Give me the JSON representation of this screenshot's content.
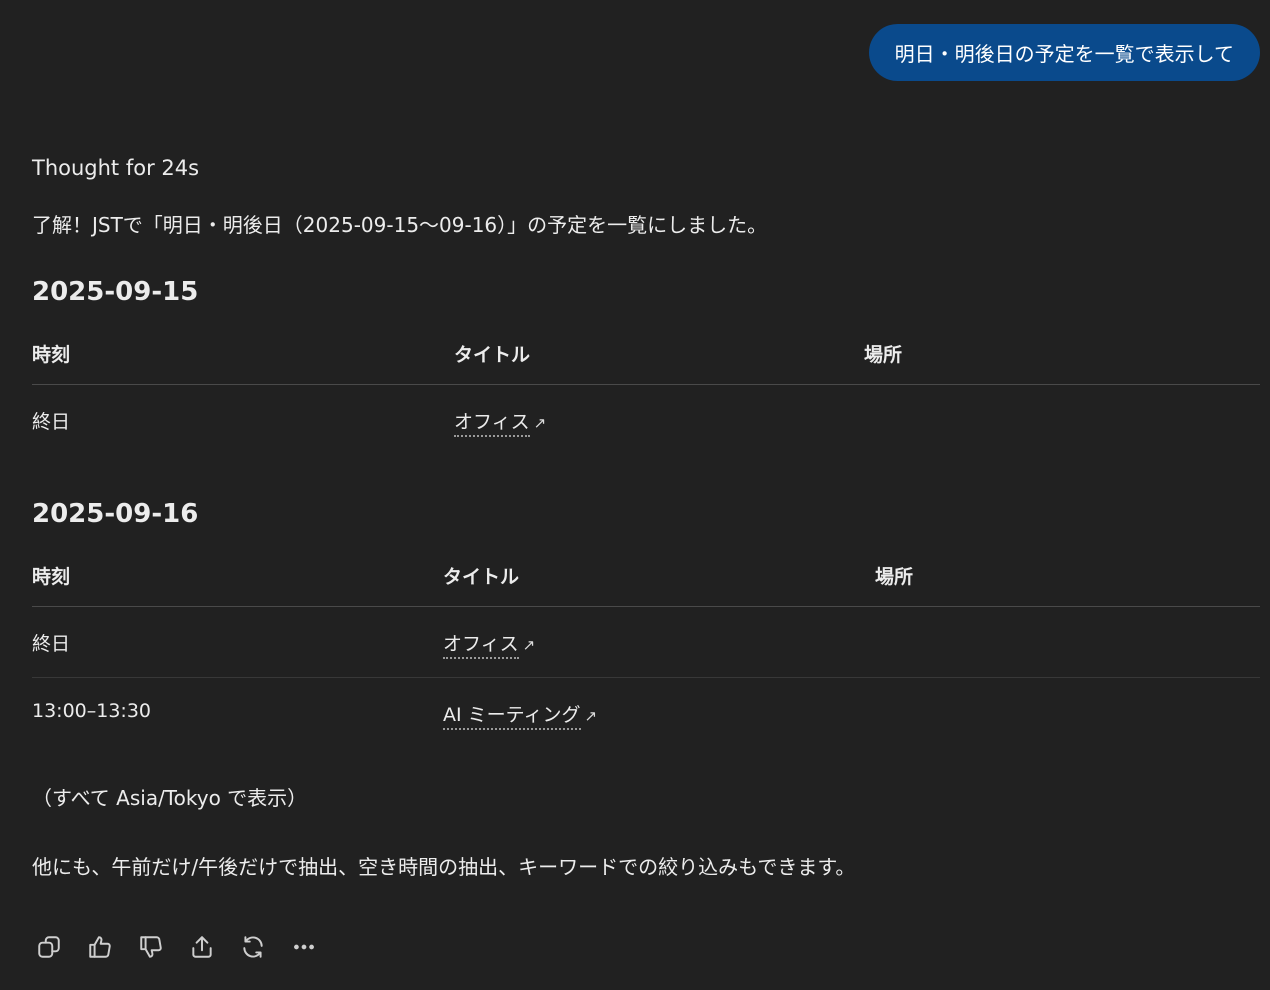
{
  "user_message": "明日・明後日の予定を一覧で表示して",
  "assistant": {
    "thought_label": "Thought for 24s",
    "intro": "了解！JSTで「明日・明後日（2025-09-15〜09-16）」の予定を一覧にしました。",
    "days": [
      {
        "date": "2025-09-15",
        "headers": {
          "time": "時刻",
          "title": "タイトル",
          "place": "場所"
        },
        "rows": [
          {
            "time": "終日",
            "title": "オフィス",
            "place": ""
          }
        ]
      },
      {
        "date": "2025-09-16",
        "headers": {
          "time": "時刻",
          "title": "タイトル",
          "place": "場所"
        },
        "rows": [
          {
            "time": "終日",
            "title": "オフィス",
            "place": ""
          },
          {
            "time": "13:00–13:30",
            "title": "AI ミーティング",
            "place": ""
          }
        ]
      }
    ],
    "external_link_glyph": "↗",
    "timezone_note": "（すべて Asia/Tokyo で表示）",
    "followup": "他にも、午前だけ/午後だけで抽出、空き時間の抽出、キーワードでの絞り込みもできます。"
  },
  "actions": [
    {
      "name": "copy-icon"
    },
    {
      "name": "thumbs-up-icon"
    },
    {
      "name": "thumbs-down-icon"
    },
    {
      "name": "share-icon"
    },
    {
      "name": "regenerate-icon"
    },
    {
      "name": "more-icon"
    }
  ],
  "colors": {
    "background": "#212121",
    "user_bubble": "#0a4a8c",
    "text": "#ececec"
  }
}
